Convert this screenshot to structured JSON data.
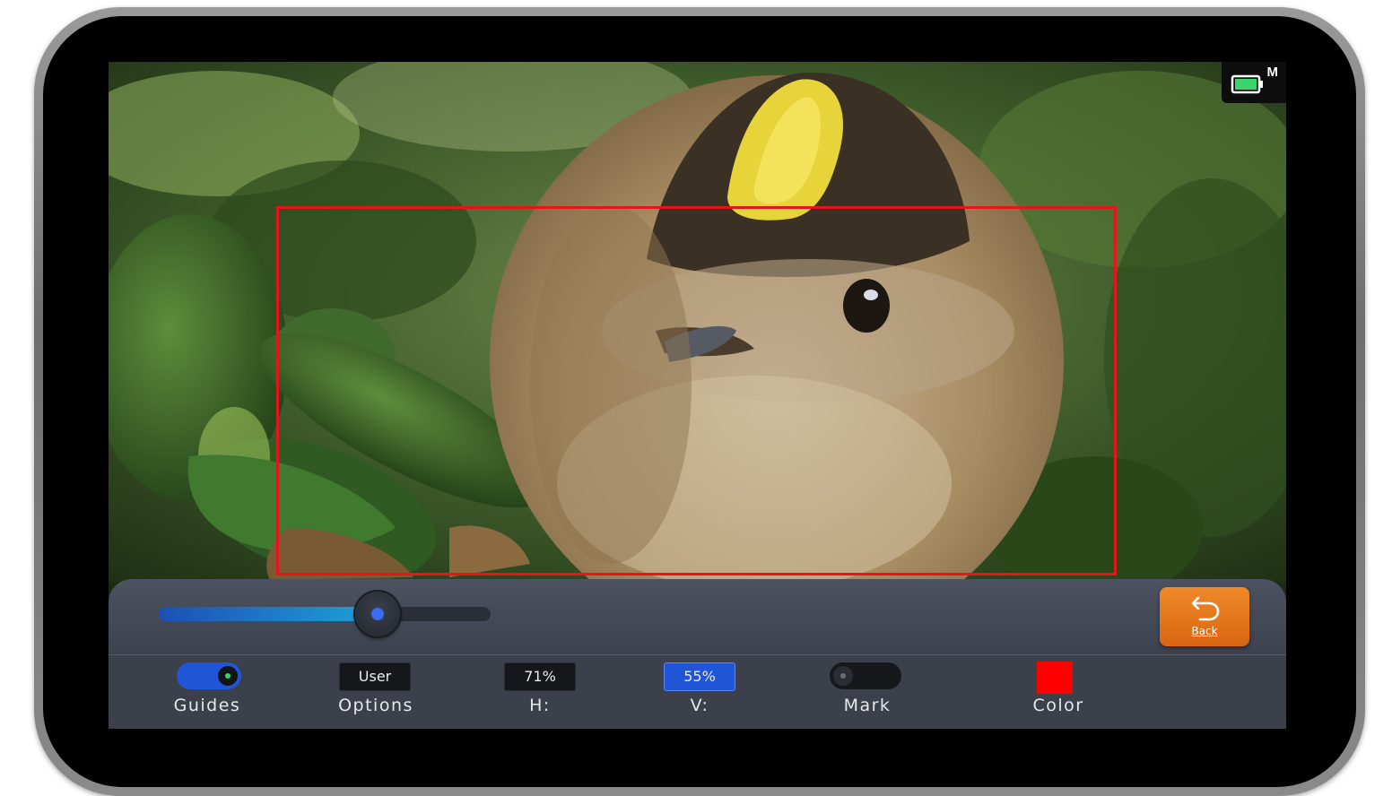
{
  "status": {
    "battery_mode_label": "M",
    "battery_color": "#3bd36b"
  },
  "guide": {
    "color": "#e5161b"
  },
  "slider": {
    "value_fraction": 0.66
  },
  "back_button": {
    "label": "Back",
    "icon": "undo-arrow-icon",
    "color": "#e8761c"
  },
  "controls": {
    "guides": {
      "label": "Guides",
      "state": "on"
    },
    "options": {
      "label": "Options",
      "value": "User"
    },
    "h": {
      "label": "H:",
      "value": "71%"
    },
    "v": {
      "label": "V:",
      "value": "55%"
    },
    "mark": {
      "label": "Mark",
      "state": "off"
    },
    "color": {
      "label": "Color",
      "swatch": "#ff0000"
    }
  }
}
